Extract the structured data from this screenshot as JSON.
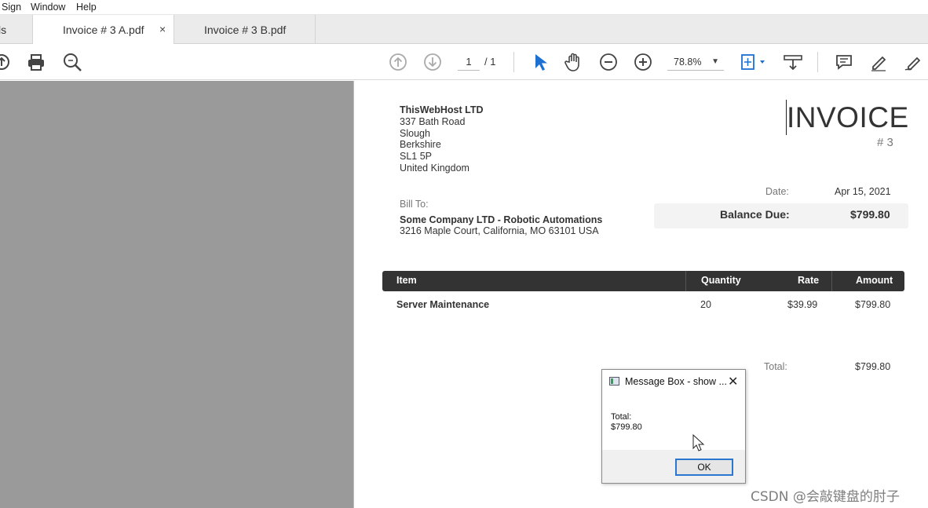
{
  "menu": {
    "items": [
      "Sign",
      "Window",
      "Help"
    ]
  },
  "tabs": [
    {
      "label": "ls"
    },
    {
      "label": "Invoice # 3 A.pdf",
      "close": "×"
    },
    {
      "label": "Invoice # 3 B.pdf"
    }
  ],
  "toolbar": {
    "page_current": "1",
    "page_total": "/  1",
    "zoom": "78.8%",
    "icons": [
      "upload-icon",
      "print-icon",
      "search-zoom-icon",
      "page-up-icon",
      "page-down-icon",
      "select-arrow-icon",
      "hand-icon",
      "zoom-out-icon",
      "zoom-in-icon",
      "fit-page-icon",
      "scroll-mode-icon",
      "comment-icon",
      "highlight-pen-icon",
      "sign-icon"
    ]
  },
  "invoice": {
    "seller_name": "ThisWebHost LTD",
    "seller_address": [
      "337 Bath Road",
      "Slough",
      "Berkshire",
      "SL1 5P",
      "United Kingdom"
    ],
    "title": "INVOICE",
    "number": "# 3",
    "bill_to_label": "Bill To:",
    "client_name": "Some Company LTD - Robotic Automations",
    "client_address": "3216 Maple Court, California, MO 63101 USA",
    "date_label": "Date:",
    "date_value": "Apr 15, 2021",
    "balance_label": "Balance Due:",
    "balance_value": "$799.80",
    "table_headers": {
      "item": "Item",
      "quantity": "Quantity",
      "rate": "Rate",
      "amount": "Amount"
    },
    "rows": [
      {
        "item": "Server Maintenance",
        "quantity": "20",
        "rate": "$39.99",
        "amount": "$799.80"
      }
    ],
    "total_label": "Total:",
    "total_value": "$799.80"
  },
  "message_box": {
    "title": "Message Box - show ...",
    "close": "✕",
    "text": "Total:\n$799.80",
    "ok_label": "OK"
  },
  "watermark": "CSDN @会敲键盘的肘子"
}
